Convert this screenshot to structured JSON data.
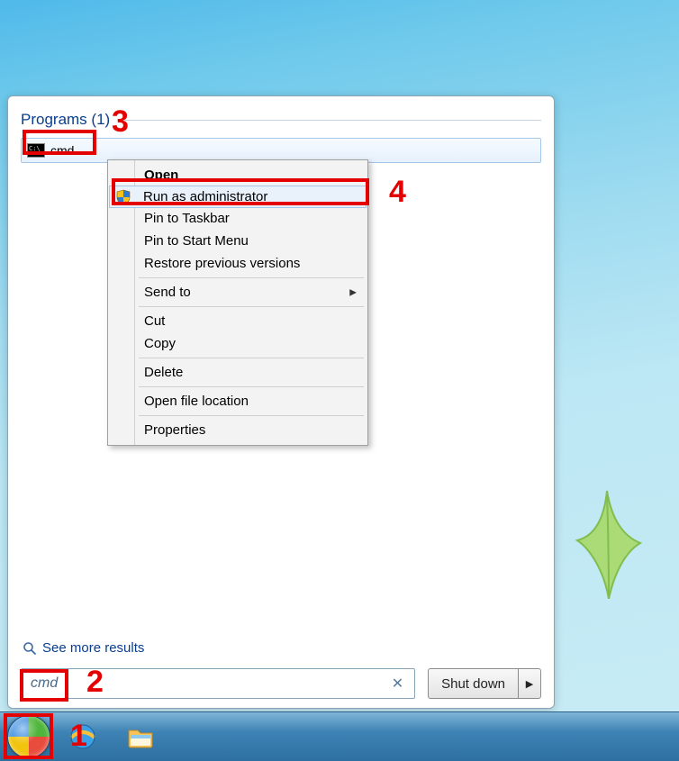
{
  "results": {
    "header": "Programs (1)",
    "item_label": "cmd"
  },
  "context_menu": {
    "open": "Open",
    "run_admin": "Run as administrator",
    "pin_taskbar": "Pin to Taskbar",
    "pin_start": "Pin to Start Menu",
    "restore_prev": "Restore previous versions",
    "send_to": "Send to",
    "cut": "Cut",
    "copy": "Copy",
    "delete": "Delete",
    "open_loc": "Open file location",
    "properties": "Properties"
  },
  "see_more": "See more results",
  "search_value": "cmd",
  "shutdown_label": "Shut down",
  "annotations": {
    "n1": "1",
    "n2": "2",
    "n3": "3",
    "n4": "4"
  }
}
